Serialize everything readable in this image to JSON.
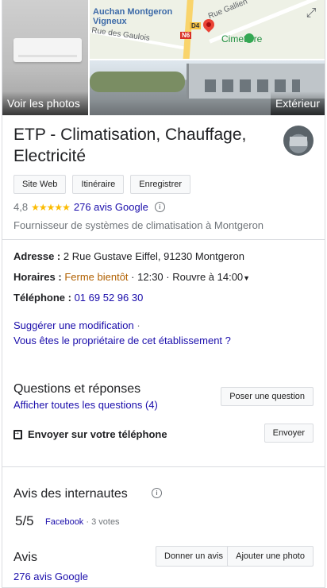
{
  "photos": {
    "left_label": "Voir les photos",
    "right_label": "Extérieur"
  },
  "map": {
    "label_auchan": "Auchan Montgeron Vigneux",
    "label_street1": "Rue Gallien",
    "label_street2": "Rue des Gaulois",
    "shield_d": "D4",
    "shield_n": "N6",
    "label_cimetiere": "Cimetière"
  },
  "business": {
    "name": "ETP - Climatisation, Chauffage, Electricité",
    "buttons": {
      "website": "Site Web",
      "directions": "Itinéraire",
      "save": "Enregistrer"
    },
    "rating": "4,8",
    "stars": "★★★★★",
    "reviews_link": "276 avis Google",
    "category": "Fournisseur de systèmes de climatisation à Montgeron"
  },
  "details": {
    "address_label": "Adresse :",
    "address_value": "2 Rue Gustave Eiffel, 91230 Montgeron",
    "hours_label": "Horaires :",
    "hours_status": "Ferme bientôt",
    "hours_sep": "·",
    "hours_time": "12:30",
    "hours_reopen": "Rouvre à 14:00",
    "phone_label": "Téléphone :",
    "phone_value": "01 69 52 96 30"
  },
  "suggest": {
    "edit_link": "Suggérer une modification",
    "sep": "·",
    "owner_link": "Vous êtes le propriétaire de cet établissement ?"
  },
  "qa": {
    "title": "Questions et réponses",
    "all_link": "Afficher toutes les questions (4)",
    "ask_button": "Poser une question"
  },
  "send": {
    "label": "Envoyer sur votre téléphone",
    "button": "Envoyer"
  },
  "web_reviews": {
    "title": "Avis des internautes",
    "score": "5/5",
    "source": "Facebook",
    "votes": "· 3 votes"
  },
  "reviews": {
    "title": "Avis",
    "google_link": "276 avis Google",
    "write_button": "Donner un avis",
    "add_photo_button": "Ajouter une photo"
  }
}
